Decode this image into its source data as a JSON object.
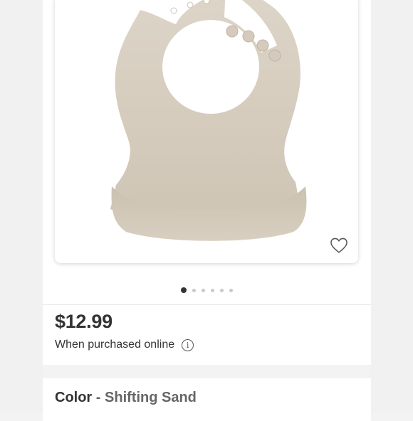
{
  "product": {
    "image_alt": "silicone baby bib",
    "favorite_icon": "heart-outline-icon",
    "price": "$12.99",
    "purchase_note": "When purchased online",
    "info_icon": "info-icon",
    "info_symbol": "i"
  },
  "carousel": {
    "total": 6,
    "active_index": 0
  },
  "color": {
    "label": "Color",
    "separator": "-",
    "value": "Shifting Sand"
  },
  "colors": {
    "bib": "#d9d0c2",
    "bib_shade": "#cbc1b1",
    "text": "#333333",
    "muted": "#666666"
  }
}
